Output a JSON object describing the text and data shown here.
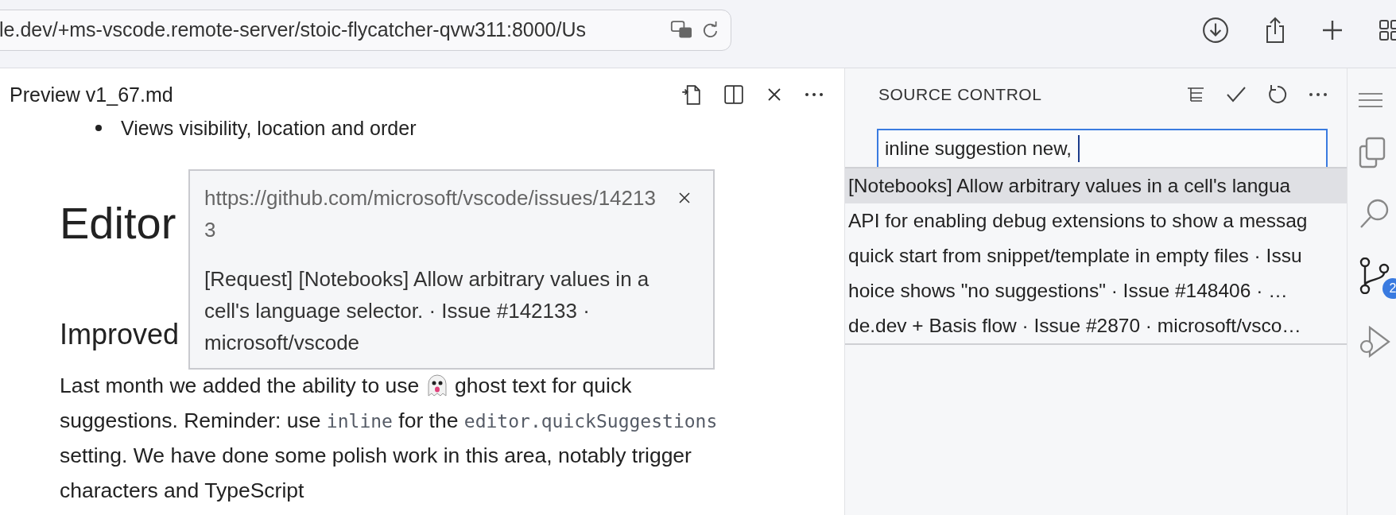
{
  "browser": {
    "url": "le.dev/+ms-vscode.remote-server/stoic-flycatcher-qvw311:8000/Us"
  },
  "editor": {
    "tab_title": "Preview v1_67.md",
    "bullet": "Views visibility, location and order",
    "heading": "Editor",
    "subheading": "Improved",
    "paragraph": [
      {
        "kind": "text",
        "text": "Last month we added the ability to use "
      },
      {
        "kind": "emoji"
      },
      {
        "kind": "text",
        "text": " ghost text for quick suggestions. Reminder: use "
      },
      {
        "kind": "code",
        "text": "inline"
      },
      {
        "kind": "text",
        "text": " for the "
      },
      {
        "kind": "code",
        "text": "editor.quickSuggestions"
      },
      {
        "kind": "text",
        "text": " setting. We have done some polish work in this area, notably trigger characters and TypeScript"
      }
    ]
  },
  "hover": {
    "url": "https://github.com/microsoft/vscode/issues/142133",
    "text": "[Request] [Notebooks] Allow arbitrary values in a cell's language selector. · Issue #142133 · microsoft/vscode"
  },
  "source_control": {
    "title": "SOURCE CONTROL",
    "input_value": "inline suggestion new,",
    "suggestions": [
      {
        "text": "[Notebooks] Allow arbitrary values in a cell's langua",
        "selected": true
      },
      {
        "text": "API for enabling debug extensions to show a messag",
        "selected": false
      },
      {
        "text": "quick start from snippet/template in empty files · Issu",
        "selected": false
      },
      {
        "text": "hoice shows \"no suggestions\" · Issue #148406 · …",
        "selected": false
      },
      {
        "text": "de.dev + Basis flow · Issue #2870 · microsoft/vsco…",
        "selected": false
      }
    ]
  },
  "activity_bar": {
    "badge": "2"
  }
}
